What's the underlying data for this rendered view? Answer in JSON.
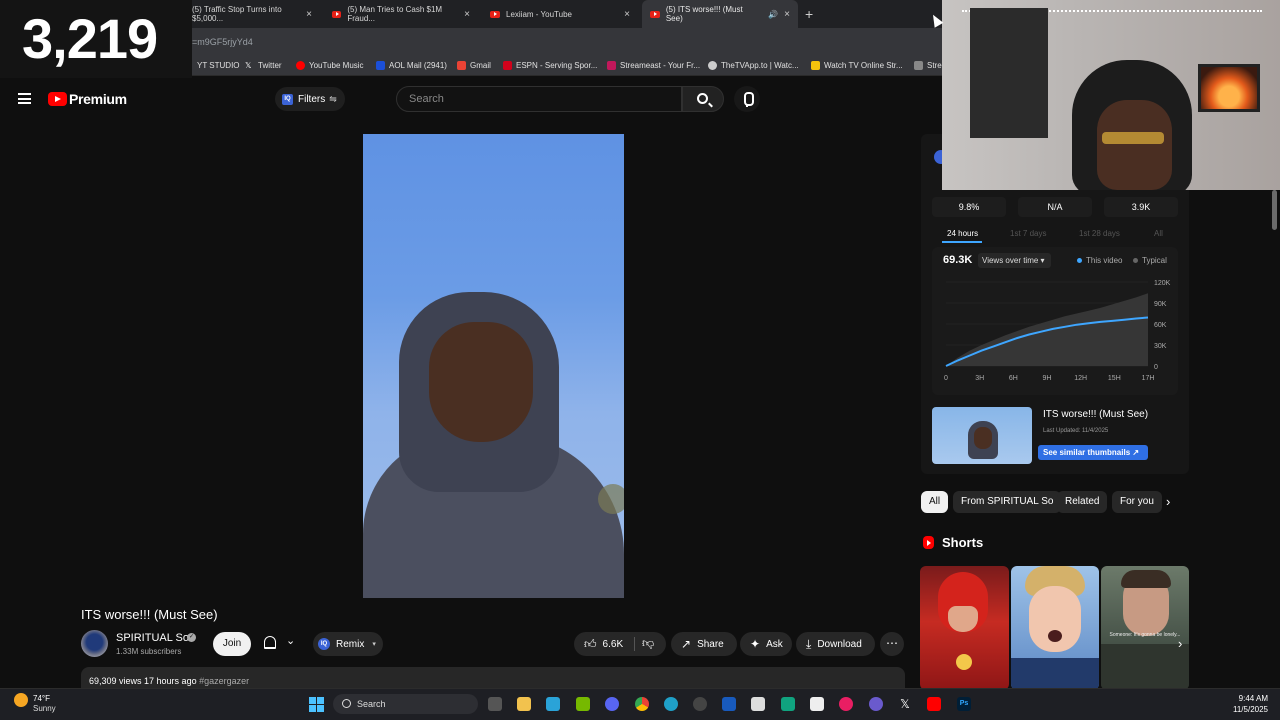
{
  "overlay": {
    "counter": "3,219"
  },
  "browser": {
    "tabs": [
      {
        "title": "(5) Traffic Stop Turns into $5,000..."
      },
      {
        "title": "(5) Man Tries to Cash $1M Fraud..."
      },
      {
        "title": "Lexiiam - YouTube"
      },
      {
        "title": "(5) ITS worse!!! (Must See)"
      }
    ],
    "url": "=m9GF5rjyYd4",
    "bookmarks": [
      "YT STUDIO",
      "Twitter",
      "YouTube Music",
      "AOL Mail (2941)",
      "Gmail",
      "ESPN - Serving Spor...",
      "Streameast - Your Fr...",
      "TheTVApp.to | Watc...",
      "Watch TV Online Str...",
      "Stre"
    ]
  },
  "header": {
    "brand": "Premium",
    "filters_label": "Filters",
    "search_placeholder": "Search"
  },
  "video": {
    "title": "ITS worse!!! (Must See)",
    "channel": "SPIRITUAL So",
    "subscribers": "1.33M subscribers",
    "join_label": "Join",
    "remix_label": "Remix",
    "likes": "6.6K",
    "share_label": "Share",
    "ask_label": "Ask",
    "download_label": "Download",
    "views_line": "69,309 views  17 hours ago",
    "hashtag": "#gazergazer"
  },
  "analytics": {
    "stats": [
      "9.8%",
      "N/A",
      "3.9K"
    ],
    "tabs": [
      "24 hours",
      "1st 7 days",
      "1st 28 days",
      "All"
    ],
    "current_views": "69.3K",
    "metric_dropdown": "Views over time",
    "legend_this": "This video",
    "legend_typical": "Typical",
    "thumb_title": "ITS worse!!! (Must See)",
    "last_updated": "Last Updated: 11/4/2025",
    "similar_button": "See similar thumbnails"
  },
  "chart_data": {
    "type": "area",
    "title": "",
    "xlabel": "",
    "ylabel": "",
    "x_ticks": [
      "0",
      "3H",
      "6H",
      "9H",
      "12H",
      "15H",
      "17H"
    ],
    "y_ticks": [
      "120K",
      "90K",
      "60K",
      "30K",
      "0"
    ],
    "ylim": [
      0,
      120000
    ],
    "x": [
      0,
      1,
      2,
      3,
      4,
      5,
      6,
      7,
      8,
      9,
      10,
      11,
      12,
      13,
      14,
      15,
      16,
      17
    ],
    "series": [
      {
        "name": "This video",
        "color": "#3ea6ff",
        "values": [
          0,
          8000,
          15000,
          22000,
          28000,
          34000,
          40000,
          45000,
          49000,
          53000,
          56000,
          59000,
          61000,
          63000,
          64500,
          66000,
          67800,
          69300
        ]
      },
      {
        "name": "Typical",
        "color": "#3a3a3a",
        "values": [
          0,
          12000,
          22000,
          30000,
          37000,
          44000,
          50000,
          56000,
          61000,
          66000,
          71000,
          75000,
          79000,
          83000,
          88000,
          93000,
          98000,
          104000
        ]
      }
    ]
  },
  "chips": [
    "All",
    "From SPIRITUAL So",
    "Related",
    "For you"
  ],
  "shorts": {
    "label": "Shorts",
    "caption3": "Someone: It's gonna be lonely..."
  },
  "taskbar": {
    "temp": "74°F",
    "weather": "Sunny",
    "search_label": "Search",
    "time": "9:44 AM",
    "date": "11/5/2025"
  }
}
